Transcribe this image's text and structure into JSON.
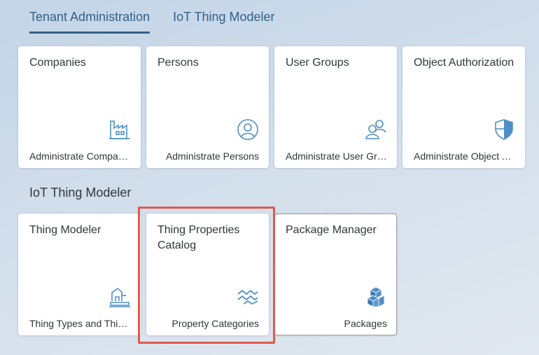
{
  "tabs": [
    {
      "label": "Tenant Administration"
    },
    {
      "label": "IoT Thing Modeler"
    }
  ],
  "groups": [
    {
      "tiles": [
        {
          "title": "Companies",
          "subtitle": "Administrate Companies",
          "icon": "factory-icon"
        },
        {
          "title": "Persons",
          "subtitle": "Administrate Persons",
          "icon": "person-icon"
        },
        {
          "title": "User Groups",
          "subtitle": "Administrate User Groups",
          "icon": "user-group-icon"
        },
        {
          "title": "Object Authorization",
          "subtitle": "Administrate Object Authorization",
          "icon": "shield-icon"
        }
      ]
    },
    {
      "title": "IoT Thing Modeler",
      "tiles": [
        {
          "title": "Thing Modeler",
          "subtitle": "Thing Types and Things",
          "icon": "thing-modeler-icon"
        },
        {
          "title": "Thing Properties Catalog",
          "subtitle": "Property Categories",
          "icon": "property-waves-icon",
          "highlighted": true
        },
        {
          "title": "Package Manager",
          "subtitle": "Packages",
          "icon": "package-cubes-icon",
          "focused": true
        }
      ]
    }
  ],
  "colors": {
    "accent": "#346187",
    "icon": "#4f8fc6",
    "highlight": "#e05a4e"
  }
}
